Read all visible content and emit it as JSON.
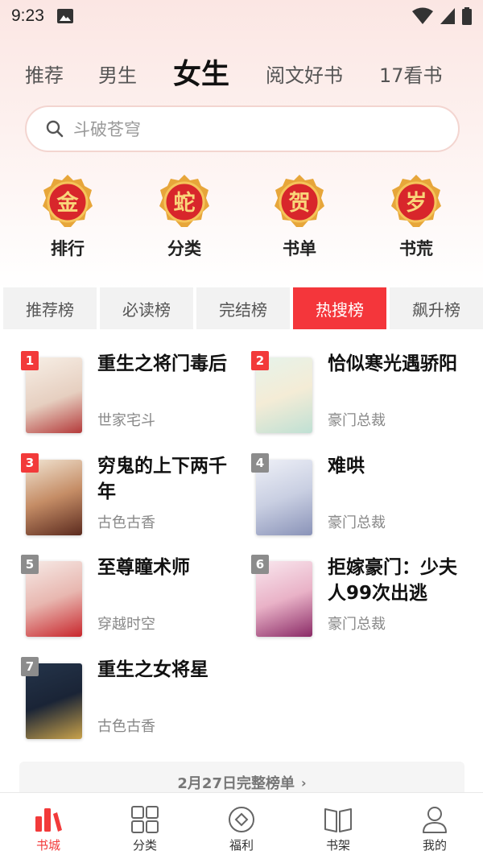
{
  "status_bar": {
    "time": "9:23"
  },
  "top_tabs": [
    "推荐",
    "男生",
    "女生",
    "阅文好书",
    "17看书"
  ],
  "active_top_tab": "女生",
  "search": {
    "placeholder": "斗破苍穹"
  },
  "quick_entries": [
    {
      "glyph": "金",
      "label": "排行"
    },
    {
      "glyph": "蛇",
      "label": "分类"
    },
    {
      "glyph": "贺",
      "label": "书单"
    },
    {
      "glyph": "岁",
      "label": "书荒"
    }
  ],
  "rank_tabs": [
    "推荐榜",
    "必读榜",
    "完结榜",
    "热搜榜",
    "飙升榜"
  ],
  "active_rank_tab": "热搜榜",
  "books": [
    {
      "rank": "1",
      "title": "重生之将门毒后",
      "genre": "世家宅斗"
    },
    {
      "rank": "2",
      "title": "恰似寒光遇骄阳",
      "genre": "豪门总裁"
    },
    {
      "rank": "3",
      "title": "穷鬼的上下两千年",
      "genre": "古色古香"
    },
    {
      "rank": "4",
      "title": "难哄",
      "genre": "豪门总裁"
    },
    {
      "rank": "5",
      "title": "至尊瞳术师",
      "genre": "穿越时空"
    },
    {
      "rank": "6",
      "title": "拒嫁豪门：少夫人99次出逃",
      "genre": "豪门总裁"
    },
    {
      "rank": "7",
      "title": "重生之女将星",
      "genre": "古色古香"
    }
  ],
  "full_list_link": "2月27日完整榜单",
  "bottom_nav": [
    {
      "label": "书城",
      "icon": "bookstore-icon"
    },
    {
      "label": "分类",
      "icon": "category-grid-icon"
    },
    {
      "label": "福利",
      "icon": "welfare-icon"
    },
    {
      "label": "书架",
      "icon": "bookshelf-icon"
    },
    {
      "label": "我的",
      "icon": "profile-icon"
    }
  ],
  "active_bottom_nav": "书城",
  "colors": {
    "accent": "#f4363b",
    "rank_top": "#f23a3a",
    "rank_other": "#8c8c8c"
  }
}
